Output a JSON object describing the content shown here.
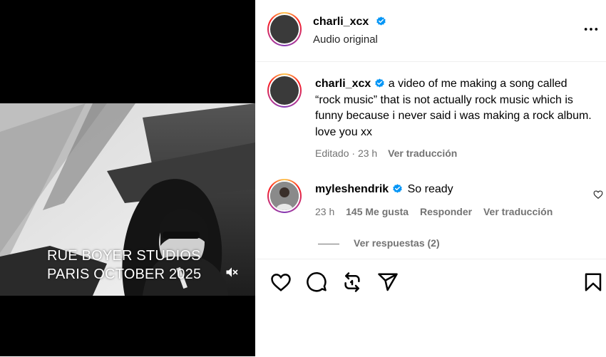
{
  "video": {
    "overlay_line1": "RUE BOYER STUDIOS",
    "overlay_line2": "PARIS OCTOBER 2025",
    "mute_icon": "speaker-muted-icon"
  },
  "header": {
    "username": "charli_xcx",
    "subtitle": "Audio original",
    "more_icon": "more-horizontal-icon"
  },
  "caption": {
    "username": "charli_xcx",
    "text": "a video of me making a song called “rock music” that is not actually rock music which is funny because i never said i was making a rock album. love you xx",
    "edited": "Editado",
    "separator": " · ",
    "time": "23 h",
    "translate": "Ver traducción"
  },
  "comment": {
    "username": "myleshendrik",
    "text": "So ready",
    "time": "23 h",
    "likes": "145 Me gusta",
    "reply": "Responder",
    "translate": "Ver traducción",
    "view_replies": "Ver respuestas (2)"
  },
  "actions": {
    "icons": [
      "heart-icon",
      "comment-icon",
      "repost-icon",
      "share-icon",
      "save-icon"
    ]
  },
  "colors": {
    "verified": "#0095f6",
    "muted_text": "#737373",
    "divider": "#efefef"
  }
}
